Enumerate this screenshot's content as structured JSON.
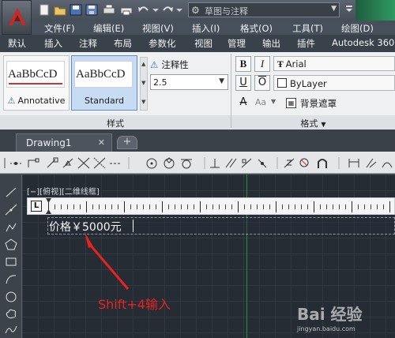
{
  "title_bar": {
    "workspace": "草图与注释"
  },
  "menu": [
    "文件(F)",
    "编辑(E)",
    "视图(V)",
    "插入(I)",
    "格式(O)",
    "工具(T)",
    "绘图(D)"
  ],
  "ribbon_tabs": [
    "默认",
    "插入",
    "注释",
    "布局",
    "参数化",
    "视图",
    "管理",
    "输出",
    "插件",
    "Autodesk 360"
  ],
  "ribbon": {
    "style_gallery": [
      {
        "preview": "AaBbCcD",
        "label": "Annotative",
        "selected": false
      },
      {
        "preview": "AaBbCcD",
        "label": "Standard",
        "selected": true
      }
    ],
    "annotative_label": "注释性",
    "text_height": "2.5",
    "style_panel_label": "样式",
    "format_buttons": {
      "bold": "B",
      "italic": "I",
      "underline": "U",
      "overline": "O",
      "strike": "A",
      "case": "Aa"
    },
    "font": "Arial",
    "color": "ByLayer",
    "mask_label": "背景遮罩",
    "format_panel_label": "格式"
  },
  "document": {
    "tab_name": "Drawing1",
    "close_glyph": "✕",
    "new_tab_glyph": "+"
  },
  "viewport": {
    "label": "[−][俯视][二维线框]",
    "ruler_box": "L",
    "typed_text": "价格￥5000元"
  },
  "annotation": {
    "text": "Shift+4输入",
    "color": "#e8231f"
  },
  "watermark": {
    "logo": "Bai 经验",
    "url": "jingyan.baidu.com"
  },
  "colors": {
    "drawing_bg": "#262c34",
    "accent_green": "#2e8a44",
    "app_red": "#c52a26"
  }
}
